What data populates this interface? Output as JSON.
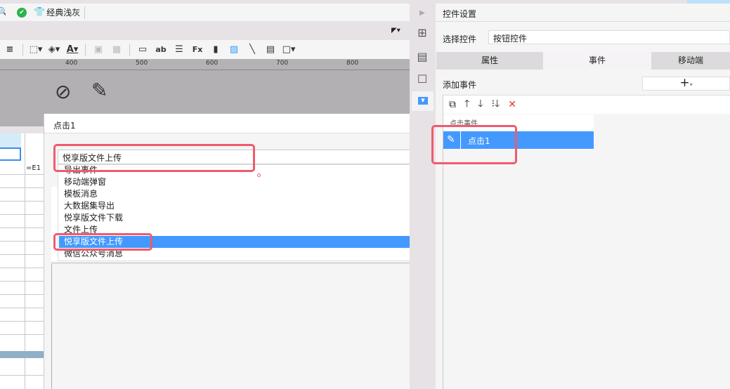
{
  "toolbar": {
    "theme_label": "经典浅灰"
  },
  "ruler": {
    "ticks": [
      "400",
      "500",
      "600",
      "700",
      "800"
    ]
  },
  "grid": {
    "cell_formula": "=E1"
  },
  "dialog": {
    "title": "点击1",
    "select_value": "悦享版文件上传",
    "options": [
      "导出事件",
      "移动端弹窗",
      "模板消息",
      "大数据集导出",
      "悦享版文件下载",
      "文件上传",
      "悦享版文件上传",
      "微信公众号消息"
    ],
    "selected_index": 6
  },
  "panel": {
    "title": "控件设置",
    "select_label": "选择控件",
    "select_value": "按钮控件",
    "tabs": [
      "属性",
      "事件",
      "移动端"
    ],
    "active_tab": "事件",
    "add_event_label": "添加事件",
    "add_button": "+",
    "event_group": "点击事件",
    "event_item": "点击1"
  },
  "colors": {
    "accent": "#4499ff",
    "highlight": "#f05a6e"
  }
}
